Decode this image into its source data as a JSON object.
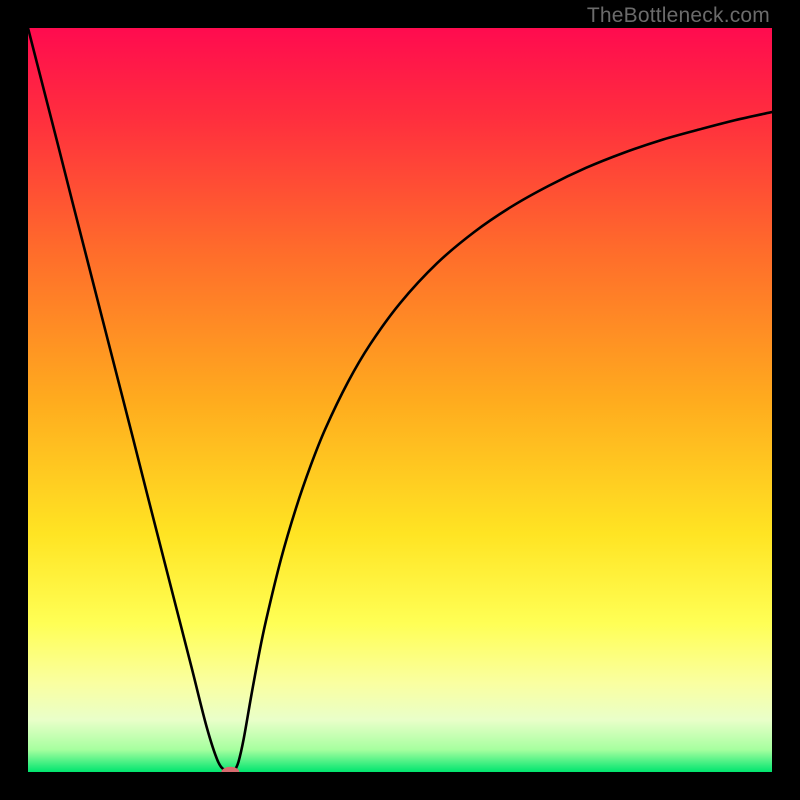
{
  "watermark": "TheBottleneck.com",
  "chart_data": {
    "type": "line",
    "title": "",
    "xlabel": "",
    "ylabel": "",
    "xlim": [
      0,
      100
    ],
    "ylim": [
      0,
      100
    ],
    "background_gradient": {
      "stops": [
        {
          "offset": 0.0,
          "color": "#ff0b4f"
        },
        {
          "offset": 0.12,
          "color": "#ff2e3e"
        },
        {
          "offset": 0.3,
          "color": "#ff6c2b"
        },
        {
          "offset": 0.5,
          "color": "#ffab1e"
        },
        {
          "offset": 0.68,
          "color": "#ffe423"
        },
        {
          "offset": 0.8,
          "color": "#ffff55"
        },
        {
          "offset": 0.88,
          "color": "#faffa0"
        },
        {
          "offset": 0.93,
          "color": "#e9ffc9"
        },
        {
          "offset": 0.97,
          "color": "#a6ff9f"
        },
        {
          "offset": 1.0,
          "color": "#00e56f"
        }
      ]
    },
    "series": [
      {
        "name": "curve",
        "x": [
          0.0,
          2.0,
          4.0,
          6.0,
          8.0,
          10.0,
          12.0,
          14.0,
          16.0,
          18.0,
          20.0,
          22.0,
          24.0,
          25.5,
          26.5,
          27.2,
          27.8,
          28.3,
          29.0,
          30.0,
          31.0,
          32.0,
          34.0,
          36.0,
          38.0,
          40.0,
          43.0,
          46.0,
          50.0,
          55.0,
          60.0,
          65.0,
          70.0,
          75.0,
          80.0,
          85.0,
          90.0,
          95.0,
          100.0
        ],
        "y": [
          100.0,
          92.2,
          84.4,
          76.5,
          68.7,
          60.9,
          53.1,
          45.3,
          37.4,
          29.6,
          21.8,
          14.0,
          6.1,
          1.5,
          0.2,
          0.0,
          0.3,
          1.4,
          4.5,
          10.2,
          15.6,
          20.4,
          28.6,
          35.4,
          41.2,
          46.2,
          52.4,
          57.5,
          63.0,
          68.4,
          72.6,
          76.0,
          78.8,
          81.2,
          83.2,
          84.9,
          86.3,
          87.6,
          88.7
        ]
      }
    ],
    "marker": {
      "name": "min-marker",
      "x": 27.2,
      "y": 0.0,
      "color": "#d86a6f",
      "rx_ratio": 0.012,
      "ry_ratio": 0.007
    }
  }
}
